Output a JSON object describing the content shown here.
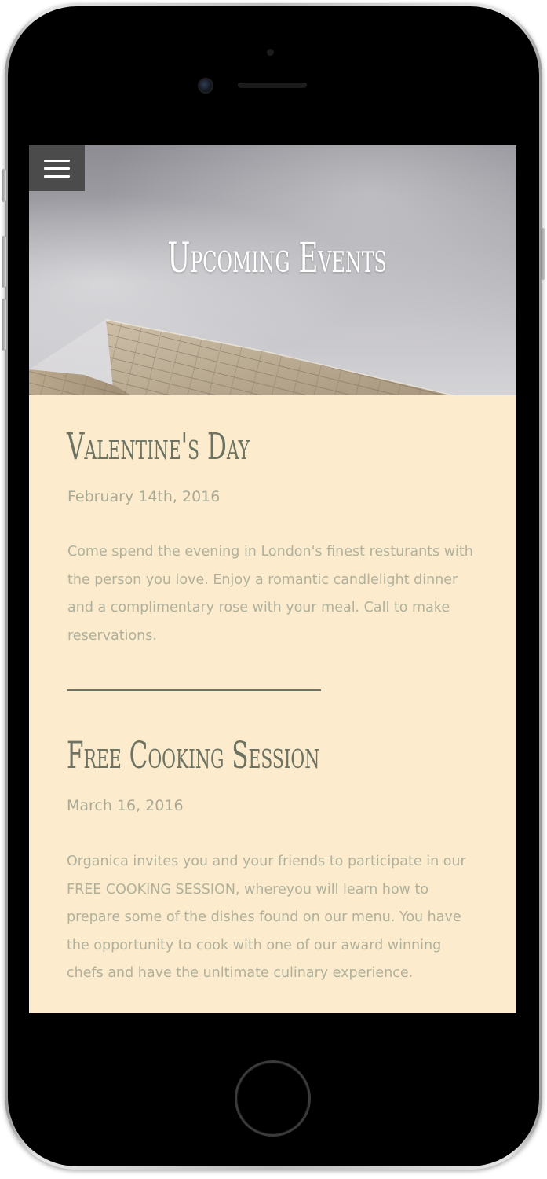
{
  "header": {
    "menu_label": "Menu",
    "title": "Upcoming Events"
  },
  "events": [
    {
      "title": "Valentine's Day",
      "date": "February 14th, 2016",
      "description": "Come spend the evening in London's finest resturants with the person you love. Enjoy a romantic candlelight dinner and a complimentary rose with your meal. Call to make reservations."
    },
    {
      "title": "Free Cooking Session",
      "date": "March 16, 2016",
      "description": "Organica invites you and your friends to participate in our FREE COOKING SESSION, whereyou will learn how to prepare some of the dishes found on our menu. You have the opportunity to cook with one of our award winning chefs and have the unltimate culinary experience."
    }
  ],
  "colors": {
    "background": "#fcebcd",
    "heading": "#6c7363",
    "body_text": "#b0b19c",
    "menu_button": "#4b4b4b"
  },
  "icons": {
    "menu": "hamburger-icon"
  }
}
